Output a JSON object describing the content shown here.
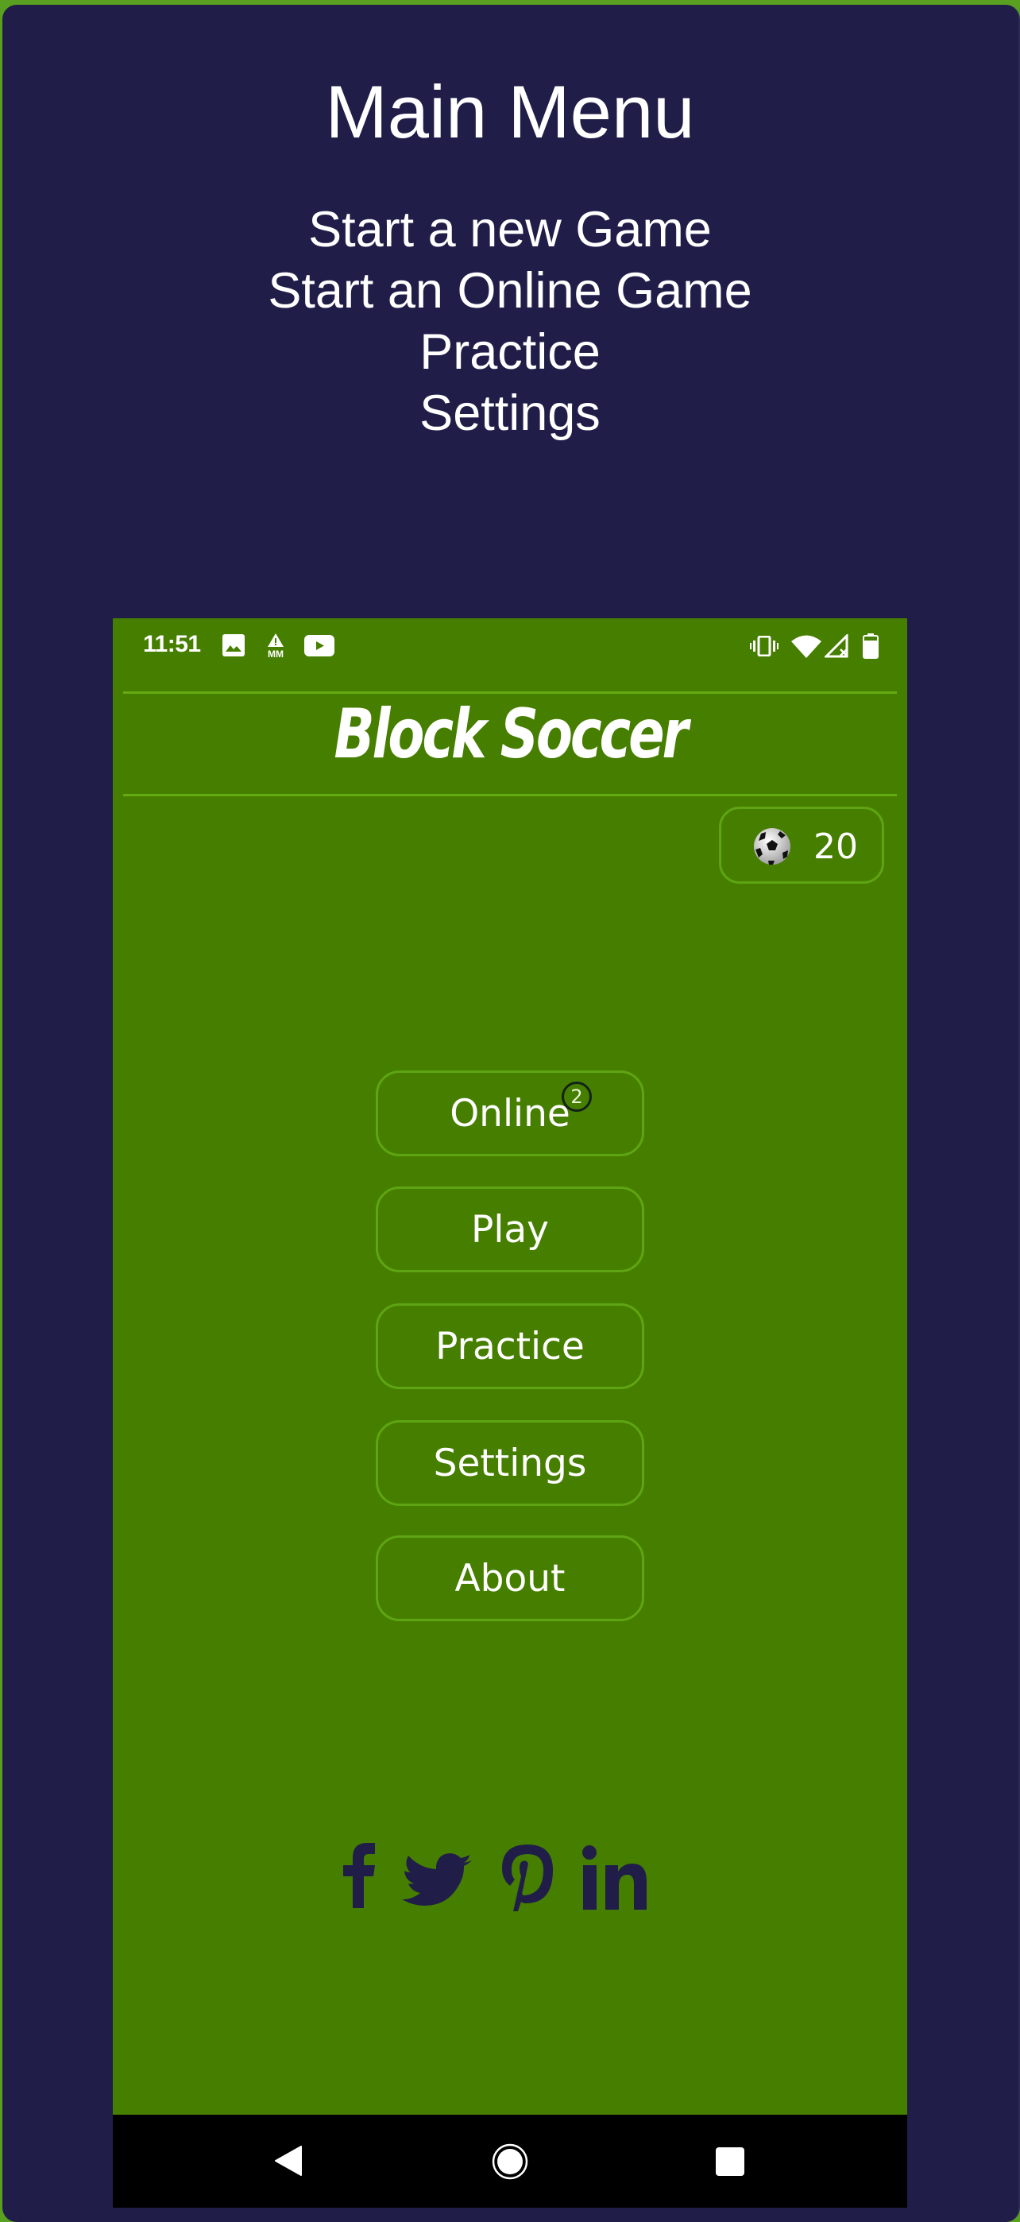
{
  "colors": {
    "frame_bg": "#201e48",
    "frame_border": "#5aa020",
    "app_bg": "#467f00",
    "accent_line": "#64ab12",
    "social_icon": "#201e48",
    "navbar": "#000000"
  },
  "main_menu": {
    "title": "Main Menu",
    "items": [
      {
        "label": "Start a new Game"
      },
      {
        "label": "Start an Online Game"
      },
      {
        "label": "Practice"
      },
      {
        "label": "Settings"
      }
    ]
  },
  "phone": {
    "status_bar": {
      "time": "11:51",
      "left_icons": [
        "image-icon",
        "drive-warning-icon",
        "youtube-icon"
      ],
      "right_icons": [
        "vibrate-icon",
        "wifi-icon",
        "no-signal-icon",
        "battery-icon"
      ]
    },
    "app": {
      "title": "Block Soccer",
      "ball_count": "20",
      "buttons": [
        {
          "label": "Online",
          "badge": "2"
        },
        {
          "label": "Play"
        },
        {
          "label": "Practice"
        },
        {
          "label": "Settings"
        },
        {
          "label": "About"
        }
      ],
      "social": [
        "facebook-icon",
        "twitter-icon",
        "pinterest-icon",
        "linkedin-icon"
      ]
    },
    "nav_bar": [
      "back-icon",
      "home-icon",
      "recents-icon"
    ]
  }
}
